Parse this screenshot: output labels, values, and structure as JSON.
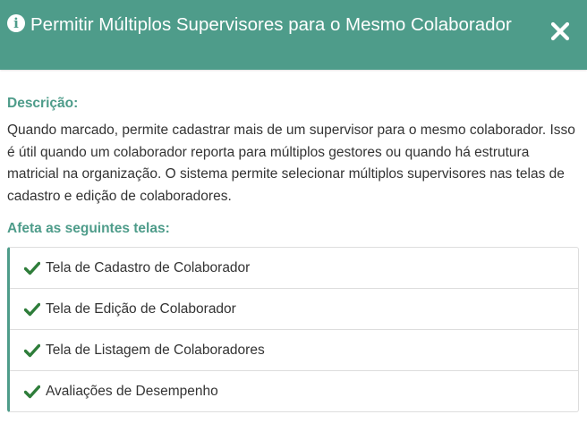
{
  "modal": {
    "title": "Permitir Múltiplos Supervisores para o Mesmo Colaborador",
    "header_icon": "info-circle-icon",
    "close_icon": "close-icon",
    "description_label": "Descrição:",
    "description_text": "Quando marcado, permite cadastrar mais de um supervisor para o mesmo colaborador. Isso é útil quando um colaborador reporta para múltiplos gestores ou quando há estrutura matricial na organização. O sistema permite selecionar múltiplos supervisores nas telas de cadastro e edição de colaboradores.",
    "affected_label": "Afeta as seguintes telas:",
    "affected_screens": [
      {
        "label": "Tela de Cadastro de Colaborador",
        "icon": "check-icon"
      },
      {
        "label": "Tela de Edição de Colaborador",
        "icon": "check-icon"
      },
      {
        "label": "Tela de Listagem de Colaboradores",
        "icon": "check-icon"
      },
      {
        "label": "Avaliações de Desempenho",
        "icon": "check-icon"
      }
    ]
  },
  "colors": {
    "accent": "#4e9c8a",
    "check": "#2e7d3a",
    "text": "#333333",
    "border": "#dddddd"
  }
}
